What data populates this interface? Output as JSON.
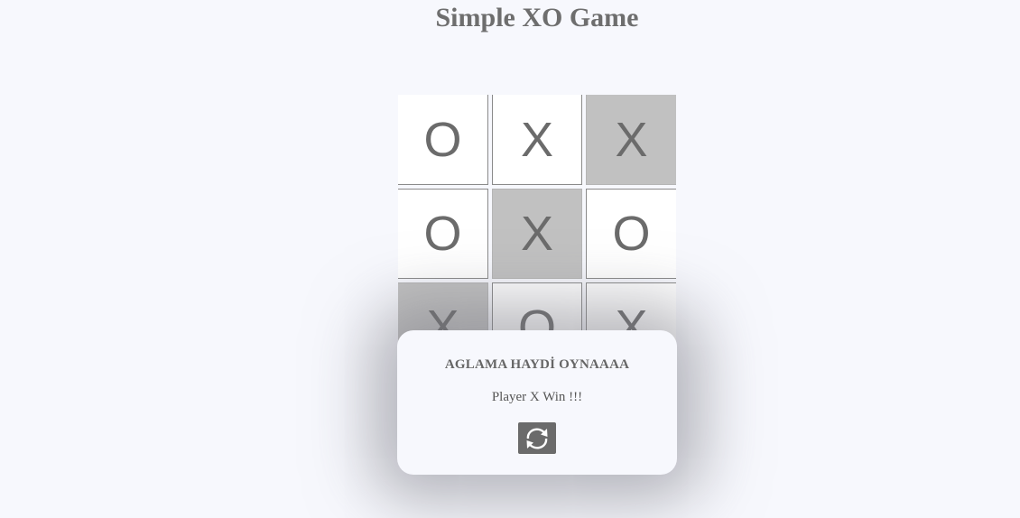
{
  "title": "Simple XO Game",
  "board": {
    "cells": [
      {
        "value": "O",
        "winning": false
      },
      {
        "value": "X",
        "winning": false
      },
      {
        "value": "X",
        "winning": true
      },
      {
        "value": "O",
        "winning": false
      },
      {
        "value": "X",
        "winning": true
      },
      {
        "value": "O",
        "winning": false
      },
      {
        "value": "X",
        "winning": true
      },
      {
        "value": "O",
        "winning": false
      },
      {
        "value": "X",
        "winning": false
      }
    ]
  },
  "modal": {
    "title": "AGLAMA HAYDİ OYNAAAA",
    "message": "Player X Win !!!",
    "restart_icon": "refresh-icon"
  },
  "colors": {
    "background": "#f7f8fd",
    "winning_cell": "#c1c1c1",
    "text": "#6b6b6b",
    "button": "#6b6b6b"
  }
}
